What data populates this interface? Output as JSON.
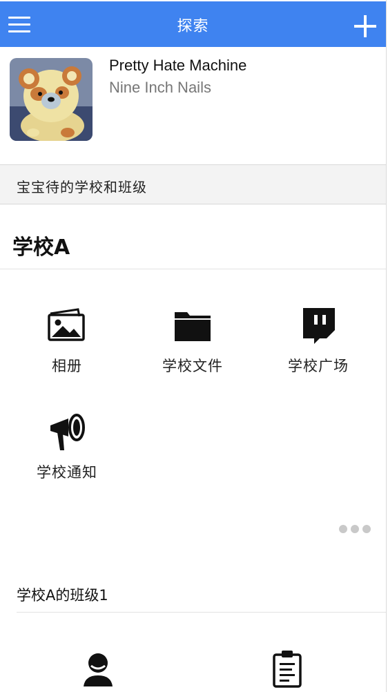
{
  "header": {
    "title": "探索"
  },
  "now_playing": {
    "title": "Pretty Hate Machine",
    "artist": "Nine Inch Nails"
  },
  "section": {
    "label": "宝宝待的学校和班级"
  },
  "school": {
    "name": "学校A",
    "features": [
      {
        "label": "相册",
        "icon": "photo-album-icon"
      },
      {
        "label": "学校文件",
        "icon": "folder-icon"
      },
      {
        "label": "学校广场",
        "icon": "chat-bubble-icon"
      },
      {
        "label": "学校通知",
        "icon": "megaphone-icon"
      }
    ]
  },
  "class_section": {
    "title": "学校A的班级1",
    "icons": [
      "user-icon",
      "clipboard-icon"
    ]
  },
  "colors": {
    "accent": "#3f83f0",
    "header_text": "#ffffff",
    "section_bg": "#f3f3f3"
  }
}
